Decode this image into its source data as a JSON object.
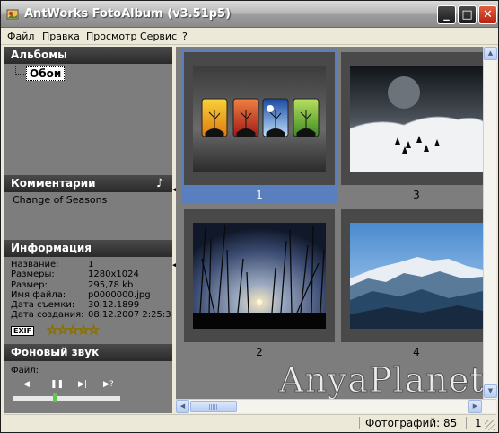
{
  "window": {
    "title": "AntWorks FotoAlbum (v3.51p5)",
    "min_label": "_",
    "max_label": "□",
    "close_label": "✕"
  },
  "menu": {
    "items": [
      {
        "label": "Файл"
      },
      {
        "label": "Правка"
      },
      {
        "label": "Просмотр"
      },
      {
        "label": "Сервис"
      },
      {
        "label": "?"
      }
    ]
  },
  "albums_panel": {
    "header": "Альбомы",
    "selected_album": "Обои"
  },
  "comments_panel": {
    "header": "Комментарии",
    "comment": "Change of Seasons",
    "music_icon": "♪"
  },
  "info_panel": {
    "header": "Информация",
    "rows": [
      {
        "label": "Название:",
        "value": "1"
      },
      {
        "label": "Размеры:",
        "value": "1280x1024"
      },
      {
        "label": "Размер:",
        "value": "295,78 kb"
      },
      {
        "label": "Имя файла:",
        "value": "p0000000.jpg"
      },
      {
        "label": "Дата съемки:",
        "value": "30.12.1899"
      },
      {
        "label": "Дата создания:",
        "value": "08.12.2007 2:25:3"
      }
    ],
    "exif_label": "EXIF",
    "rating": 0,
    "rating_max": 5
  },
  "sound_panel": {
    "header": "Фоновый звук",
    "file_label": "Файл:",
    "controls": [
      "|◀",
      "❚❚",
      "▶|",
      "▶?"
    ],
    "position": 0.39
  },
  "thumbnails": [
    {
      "label": "1",
      "selected": true,
      "image": "seasons-trees"
    },
    {
      "label": "3",
      "selected": false,
      "image": "winter-moon"
    },
    {
      "label": "2",
      "selected": false,
      "image": "sunset-reeds"
    },
    {
      "label": "4",
      "selected": false,
      "image": "mountains"
    }
  ],
  "watermark": "AnyaPlanet",
  "statusbar": {
    "photo_count": "Фотографий: 85",
    "page": "1"
  },
  "colors": {
    "selection": "#5a7fbf",
    "panel_bg": "#7d7d7d",
    "header_bg": "#2f2f2f"
  }
}
